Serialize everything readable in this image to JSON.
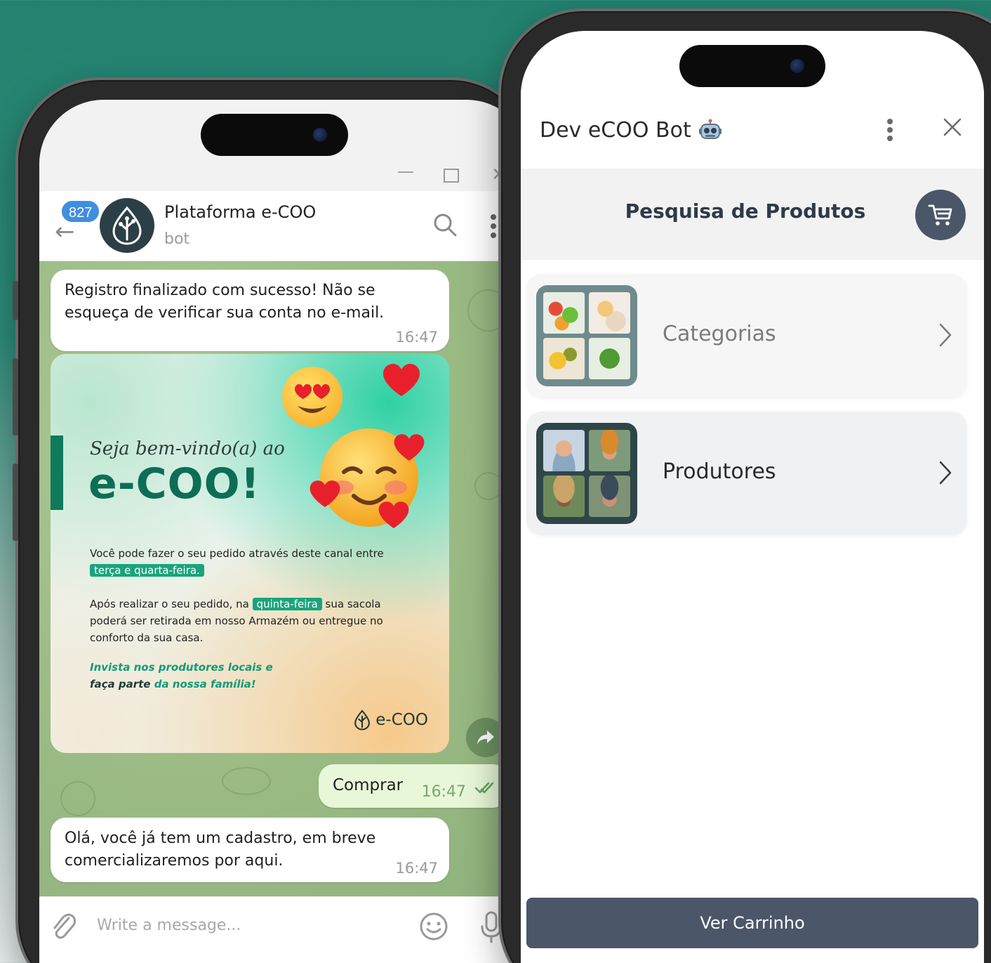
{
  "telegram": {
    "unread_count": "827",
    "chat_title": "Plataforma e-COO",
    "chat_subtitle": "bot",
    "messages": [
      {
        "text": "Registro finalizado com sucesso! Não se esqueça de verificar sua conta no e-mail.",
        "time": "16:47",
        "direction": "in"
      },
      {
        "text": "Comprar",
        "time": "16:47",
        "direction": "out"
      },
      {
        "text": "Olá, você já tem um cadastro, em breve comercializaremos por aqui.",
        "time": "16:47",
        "direction": "in"
      }
    ],
    "promo": {
      "welcome": "Seja bem-vindo(a) ao",
      "brand": "e-COO!",
      "p1_before": "Você pode fazer o seu pedido através deste canal entre ",
      "p1_highlight": "terça e quarta-feira.",
      "p2_before": "Após realizar o seu pedido, na ",
      "p2_highlight": "quinta-feira",
      "p2_after": " sua sacola poderá ser retirada em nosso Armazém ou entregue no conforto da sua casa.",
      "p3_a": "Invista nos produtores locais e",
      "p3_b": "faça parte",
      "p3_c": " da nossa família!",
      "logo_text": "e-COO"
    },
    "input_placeholder": "Write a message..."
  },
  "bot": {
    "title": "Dev eCOO Bot",
    "search_title": "Pesquisa de Produtos",
    "cards": [
      {
        "label": "Categorias"
      },
      {
        "label": "Produtores"
      }
    ],
    "cta_label": "Ver Carrinho"
  },
  "colors": {
    "background_top": "#23826f",
    "brand_green": "#0d6e56",
    "highlight_green": "#18a57c",
    "slate_button": "#4b5669",
    "telegram_blue": "#3e8fe0"
  }
}
